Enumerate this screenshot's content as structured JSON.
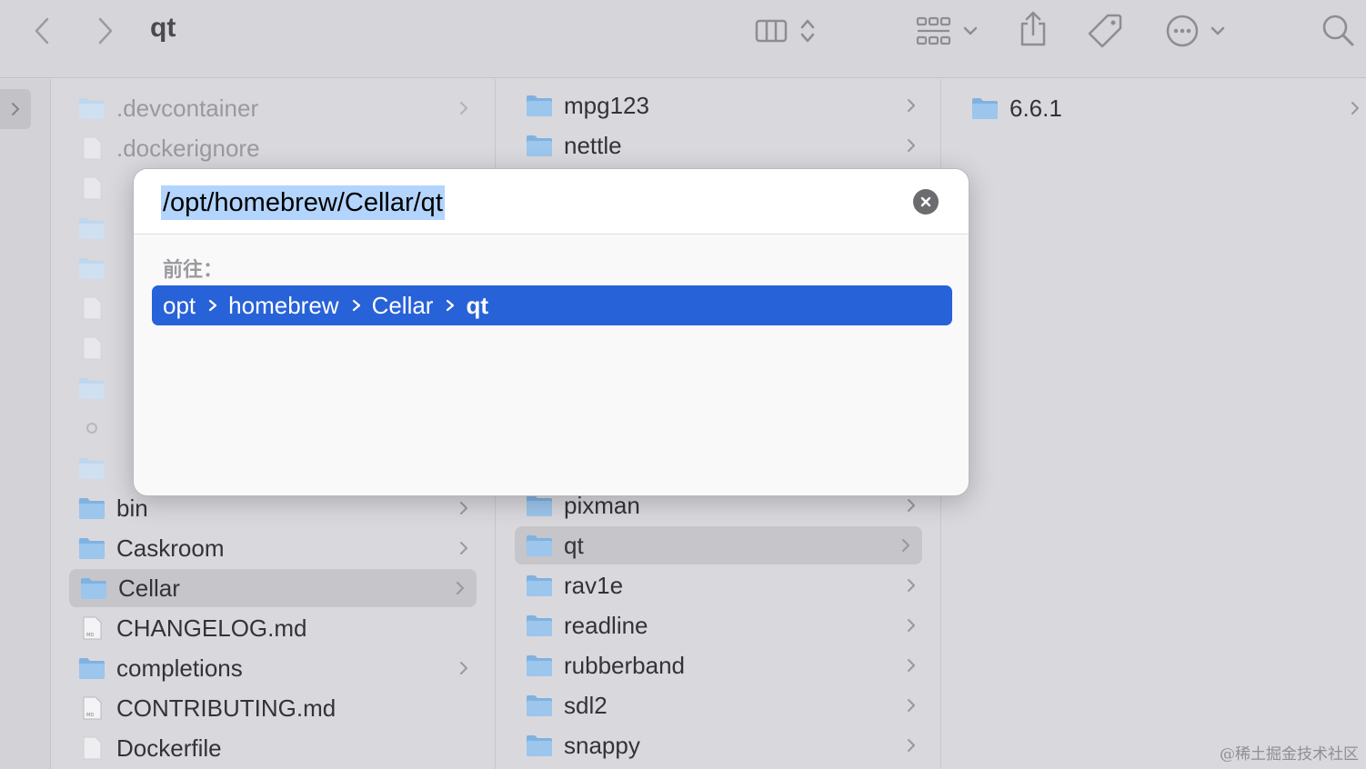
{
  "window": {
    "title": "qt"
  },
  "toolbar": {
    "icons": [
      "back-icon",
      "forward-icon",
      "column-view-icon",
      "sort-arrows-icon",
      "group-grid-icon",
      "chevron-down-icon",
      "share-icon",
      "tag-icon",
      "more-icon",
      "search-icon"
    ]
  },
  "columns": {
    "col1": [
      {
        "name": ".devcontainer",
        "type": "folder",
        "faded": true
      },
      {
        "name": ".dockerignore",
        "type": "file",
        "faded": true
      },
      {
        "name": "bin",
        "type": "folder"
      },
      {
        "name": "Caskroom",
        "type": "folder"
      },
      {
        "name": "Cellar",
        "type": "folder",
        "selected": true
      },
      {
        "name": "CHANGELOG.md",
        "type": "md"
      },
      {
        "name": "completions",
        "type": "folder"
      },
      {
        "name": "CONTRIBUTING.md",
        "type": "md"
      },
      {
        "name": "Dockerfile",
        "type": "file"
      }
    ],
    "col2": [
      {
        "name": "mpg123",
        "type": "folder"
      },
      {
        "name": "nettle",
        "type": "folder"
      },
      {
        "name": "pixman",
        "type": "folder"
      },
      {
        "name": "qt",
        "type": "folder",
        "selected": true
      },
      {
        "name": "rav1e",
        "type": "folder"
      },
      {
        "name": "readline",
        "type": "folder"
      },
      {
        "name": "rubberband",
        "type": "folder"
      },
      {
        "name": "sdl2",
        "type": "folder"
      },
      {
        "name": "snappy",
        "type": "folder"
      }
    ],
    "col3": [
      {
        "name": "6.6.1",
        "type": "folder"
      }
    ]
  },
  "dialog": {
    "path_value": "/opt/homebrew/Cellar/qt",
    "goto_label": "前往：",
    "suggestion": [
      "opt",
      "homebrew",
      "Cellar",
      "qt"
    ]
  },
  "colors": {
    "accent": "#2862d8",
    "folder": "#8fbde6"
  },
  "watermark": "@稀土掘金技术社区"
}
